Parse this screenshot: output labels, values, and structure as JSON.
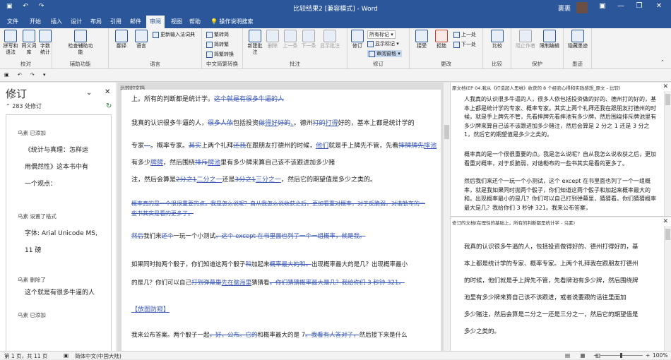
{
  "window": {
    "title": "比较结果2 [兼容模式] - Word",
    "user": "裹裹",
    "minimize": "—",
    "restore": "❐",
    "close": "✕",
    "ribbon_toggle": "▣"
  },
  "tabs": [
    "文件",
    "开始",
    "插入",
    "设计",
    "布局",
    "引用",
    "邮件",
    "审阅",
    "视图",
    "帮助",
    "操作说明搜索"
  ],
  "ribbon": {
    "groups": [
      "校对",
      "辅助功能",
      "语言",
      "中文简繁转换",
      "批注",
      "修订",
      "更改",
      "比较",
      "保护",
      "墨迹"
    ],
    "proofing": [
      "拼写和语法",
      "同义词库",
      "字数统计"
    ],
    "accessibility": [
      "检查辅助功能"
    ],
    "language": [
      "翻译",
      "语言",
      "更新输入法词典"
    ],
    "chinese": [
      "繁转简",
      "简转繁",
      "简繁转换"
    ],
    "comments": [
      "新建批注",
      "删除",
      "上一条",
      "下一条",
      "显示批注"
    ],
    "tracking": [
      "修订",
      "所有标记",
      "显示标记",
      "审阅窗格"
    ],
    "changes": [
      "接受",
      "拒绝",
      "上一处",
      "下一处"
    ],
    "compare": [
      "比较"
    ],
    "protect": [
      "阻止作者",
      "限制编辑"
    ],
    "ink": [
      "隐藏墨迹"
    ]
  },
  "review_pane": {
    "title": "修订",
    "count": "283 处修订",
    "items": [
      {
        "author": "乌素 已添加",
        "text": [
          "《统计与真理：怎样运",
          "用偶然性》这本书中有",
          "一个观点："
        ]
      },
      {
        "author": "乌素 设置了格式",
        "text": [
          "字体: Arial Unicode MS,",
          "11 磅"
        ]
      },
      {
        "author": "乌素 删除了",
        "text": [
          "这个就是有很多牛逼的人"
        ]
      },
      {
        "author": "乌素 已添加",
        "text": []
      }
    ]
  },
  "compared": {
    "title": "比较的文档",
    "l1a": "上。所有的判断都是统计学。",
    "l1b": "这个就是有很多牛逼的人",
    "l2a": "我真的认识很多牛逼的人，",
    "l2b": "很多人依",
    "l2c": "包括投资",
    "l2d": "做",
    "l2e": "得好",
    "l2f": "好的",
    "l2g": "、",
    "l2h": "。德州",
    "l2i": "打的",
    "l2j": "打得",
    "l2k": "好的，基本上都是统计学的",
    "l3a": "专家",
    "l3b": "—",
    "l3c": "。概率专家。",
    "l3d": "其实",
    "l3e": "上两个礼拜",
    "l3f": "还我",
    "l3g": "在跟朋友打德州的时候，",
    "l3h": "他们",
    "l3i": "就是手上牌先不管，先看",
    "l3j": "摔牌",
    "l3k": "牌先",
    "l3l": "摔池",
    "l4a": "有多少",
    "l4b": "牌牌",
    "l4c": "，然后围绕",
    "l4d": "排斥",
    "l4e": "牌池",
    "l4f": "里有多少牌来算自己该不该跟进加多少赌",
    "l5a": "注，然后会算是",
    "l5b": "2分之1",
    "l5c": "二分之一",
    "l5d": "还是",
    "l5e": "3分之1",
    "l5f": "三分之一",
    "l5g": "，然后它的期望值是多少之类的。",
    "l6": "概率真的是一个很很重要的点。我是怎么说呢？自从我怎么说收获之后，更加看重对概率，对于反脆弱，对谐勒布的一",
    "l7": "些书其实是看的更多了。",
    "l8a": "然后",
    "l8b": "我们来",
    "l8c": "还个",
    "l8d": "一玩一个小测试",
    "l8e": "。这个 except 在书里面也列了一个一组概率，就是我。",
    "l9a": "如果同时抛两个骰子，你们知道这两个骰子",
    "l9b": "和",
    "l9c": "加起来",
    "l9d": "概率最大的和。",
    "l9e": "出现概率最大的是几？出现概率最小",
    "l10a": "的是几？你们可以自己",
    "l10b": "打到弹幕里",
    "l10c": "先在脑海里",
    "l10d": "猜猜看",
    "l10e": "。你们猜猜概率最大是几？我给你们 3 秒钟 321。",
    "l11": "【放图防窥】",
    "l12a": "我来公布答案。两个骰子一起",
    "l12b": "，好，公布。它的",
    "l12c": "和概率最大的是 7",
    "l12d": "。我看有人答对了，",
    "l12e": "然后接下来是什么"
  },
  "original": {
    "title": "原文档(EP 04.我从《打造超人思维》收获的 8 个经验心得和实践感想_原文 - 比较)",
    "paras": [
      "人我真的认识很多牛逼的人，很多人依包括投资做的好的、德州打的好的，基本上都是统计学的专家、概率专家。其实上两个礼拜还我在跟朋友打德州的时候，就是手上牌先不管，先看摔牌先看摔池有多少牌，然后围绕排斥牌池里有多少牌来算自己该不该跟进加多少赌注，然后会算是 2 分之 1 还是 3 分之 1，然后它的期望值是多少之类的。",
      "概率真的是一个很很重要的点。我是怎么说呢？自从我怎么说收获之后，更加看重对概率，对于反脆弱，对谐勒布的一些书其实是看的更多了。",
      "然后我们来还个一玩一个小测试，这个 except 在书里面也列了一个一组概率，就是我如果同时抛两个骰子，你们知道这两个骰子和加起来概率最大的和。出现概率最小的是几？你们可以自己打到弹幕里，猜猜看。你们猜猜概率最大是几？我给你们 3 秒钟 321。我来公布答案，"
    ]
  },
  "revised": {
    "title": "修订的文档(在理性的基础上，所有的判断都是统计学 - 乌素)",
    "lines": [
      "我真的认识很多牛逼的人，包括投资做得好的、德州打得好的，基",
      "本上都是统计学的专家、概率专家。上两个礼拜我在跟朋友打德州",
      "的时候，他们就是手上牌先不管，先看牌池有多少牌，然后围绕牌",
      "池里有多少牌来算自己该不该跟进，或者说要跟的话往里面加",
      "多少赌注，然后会算是二分之一还是三分之一，然后它的期望值是",
      "多少之类的。"
    ]
  },
  "status": {
    "page": "第 1 页，共 11 页",
    "lang": "简体中文(中国大陆)",
    "zoom": "100%"
  },
  "colors": {
    "accent": "#2b579a",
    "revision": "#3d5ab8"
  }
}
